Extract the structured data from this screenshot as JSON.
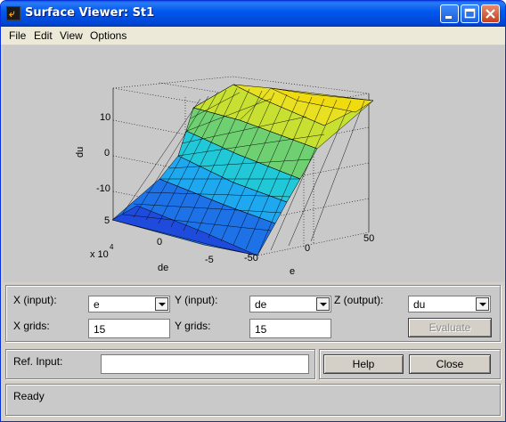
{
  "window": {
    "title": "Surface Viewer: St1"
  },
  "menu": [
    "File",
    "Edit",
    "View",
    "Options"
  ],
  "plot": {
    "zlabel": "du",
    "ylabel": "de",
    "xlabel": "e",
    "z_ticks": [
      "10",
      "0",
      "-10"
    ],
    "y_ticks": [
      "5",
      "0",
      "-5"
    ],
    "x_ticks": [
      "50",
      "0",
      "-50"
    ],
    "y_exponent": "x 10",
    "y_exponent_power": "4"
  },
  "controls": {
    "x_input_label": "X (input):",
    "x_input_value": "e",
    "y_input_label": "Y (input):",
    "y_input_value": "de",
    "z_output_label": "Z (output):",
    "z_output_value": "du",
    "x_grids_label": "X grids:",
    "x_grids_value": "15",
    "y_grids_label": "Y grids:",
    "y_grids_value": "15",
    "evaluate_label": "Evaluate",
    "ref_input_label": "Ref. Input:",
    "ref_input_value": "",
    "help_label": "Help",
    "close_label": "Close",
    "status": "Ready"
  },
  "colors": {
    "titlebar": "#0058ee",
    "panel": "#c9c9c9"
  }
}
